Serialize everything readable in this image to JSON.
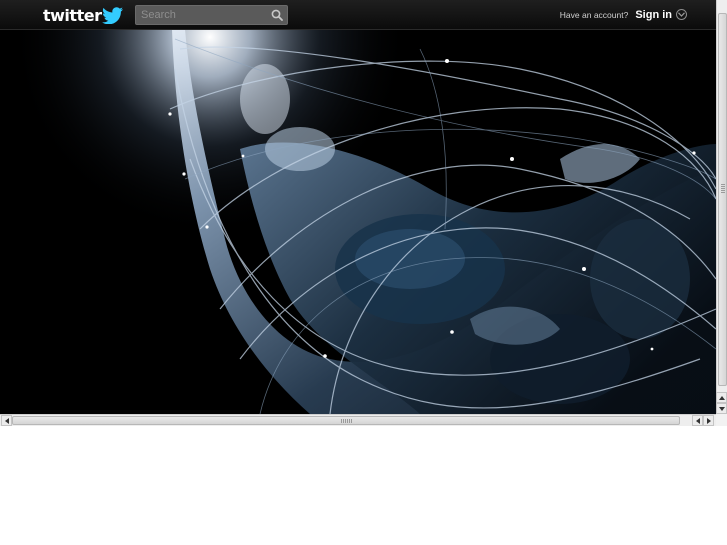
{
  "header": {
    "logo_text": "twitter",
    "search": {
      "placeholder": "Search",
      "value": ""
    },
    "have_account": "Have an account?",
    "sign_in": "Sign in"
  },
  "icons": {
    "logo_bird": "twitter-bird-icon",
    "search": "search-icon",
    "sign_in_dropdown": "chevron-down-icon"
  },
  "colors": {
    "topbar": "#111111",
    "accent_bird": "#33ccff",
    "search_bg": "#5a5a5a"
  }
}
